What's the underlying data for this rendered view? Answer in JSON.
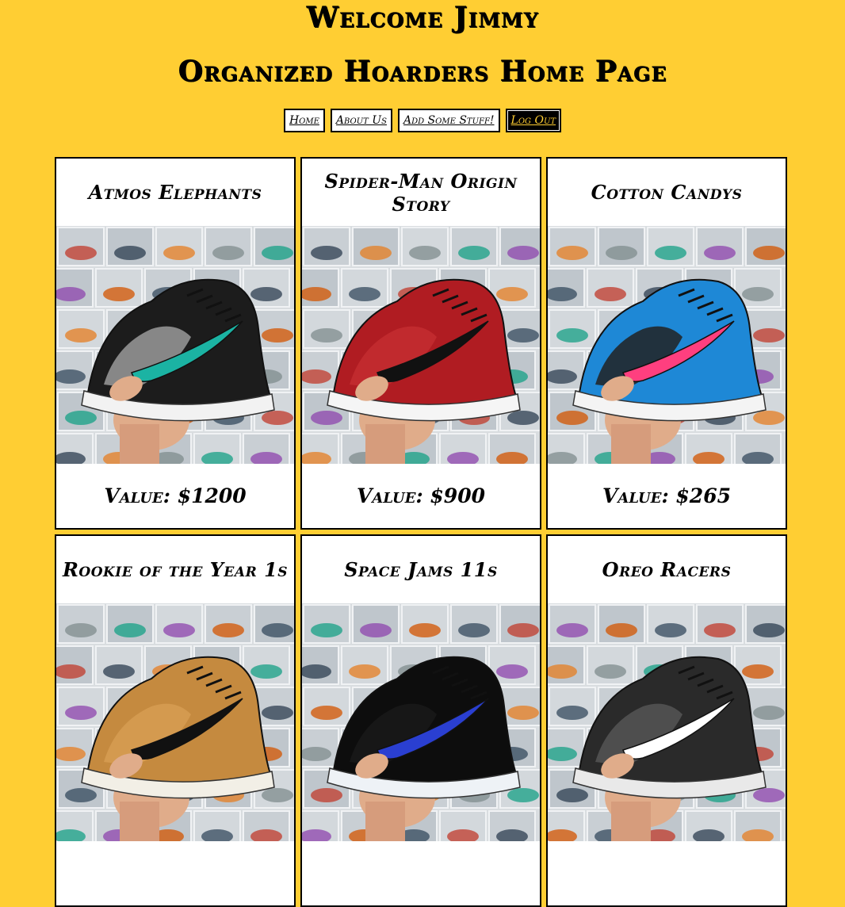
{
  "header": {
    "welcome": "Welcome Jimmy",
    "subtitle": "Organized Hoarders Home Page"
  },
  "nav": {
    "home": "Home",
    "about": "About Us",
    "add": "Add Some Stuff!",
    "logout": "Log Out"
  },
  "colors": {
    "background": "#FFCE33",
    "card": "#FFFFFF",
    "border": "#000000"
  },
  "items": [
    {
      "name": "Atmos Elephants",
      "value": "Value: $1200",
      "photo": {
        "primary": "#1c1c1c",
        "accent": "#1bb3a3",
        "sole": "#f2f2f2",
        "pattern": "#9a9a9a"
      }
    },
    {
      "name": "Spider-Man Origin Story",
      "value": "Value: $900",
      "photo": {
        "primary": "#b01c22",
        "accent": "#111111",
        "sole": "#f5f5f5",
        "pattern": "#c42d30"
      }
    },
    {
      "name": "Cotton Candys",
      "value": "Value: $265",
      "photo": {
        "primary": "#1e88d6",
        "accent": "#ff3f7f",
        "sole": "#f4f4f4",
        "pattern": "#222222"
      }
    },
    {
      "name": "Rookie of the Year 1s",
      "value": "",
      "photo": {
        "primary": "#c58a3f",
        "accent": "#111111",
        "sole": "#f2efe6",
        "pattern": "#d69c52"
      }
    },
    {
      "name": "Space Jams 11s",
      "value": "",
      "photo": {
        "primary": "#0d0d0d",
        "accent": "#2a3fd1",
        "sole": "#eef2f6",
        "pattern": "#1a1a1a"
      }
    },
    {
      "name": "Oreo Racers",
      "value": "",
      "photo": {
        "primary": "#2a2a2a",
        "accent": "#ffffff",
        "sole": "#e9e9e9",
        "pattern": "#555555"
      }
    }
  ]
}
